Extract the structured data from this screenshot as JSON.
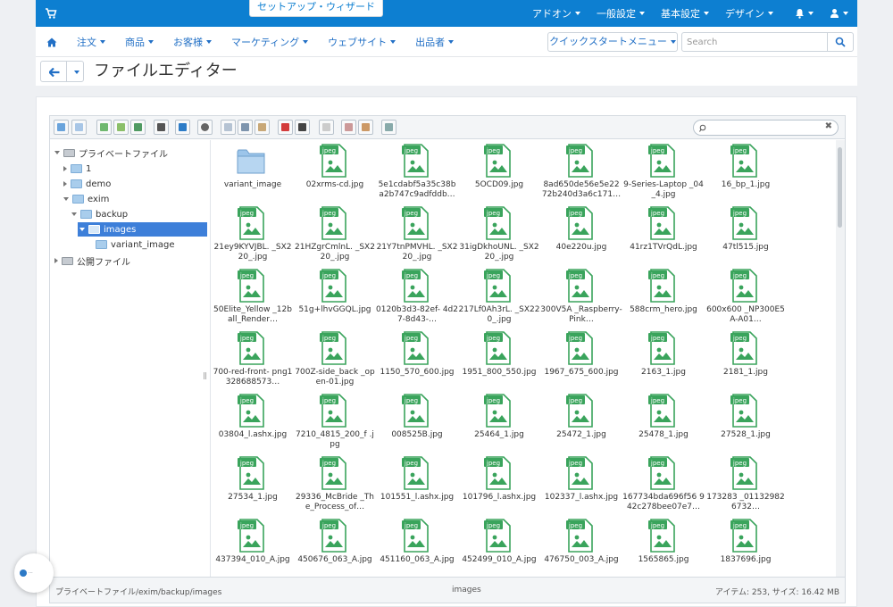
{
  "topbar": {
    "setup_wizard": "セットアップ・ウィザード",
    "menu": [
      {
        "label": "アドオン"
      },
      {
        "label": "一般設定"
      },
      {
        "label": "基本設定"
      },
      {
        "label": "デザイン"
      }
    ]
  },
  "nav": {
    "items": [
      {
        "label": "注文"
      },
      {
        "label": "商品"
      },
      {
        "label": "お客様"
      },
      {
        "label": "マーケティング"
      },
      {
        "label": "ウェブサイト"
      },
      {
        "label": "出品者"
      }
    ],
    "quickstart_label": "クイックスタートメニュー",
    "search_placeholder": "Search"
  },
  "page": {
    "title": "ファイルエディター"
  },
  "tree": {
    "nodes": [
      {
        "label": "プライベートファイル",
        "icon": "drive-icon",
        "expanded": true
      },
      {
        "label": "1",
        "icon": "folder-icon"
      },
      {
        "label": "demo",
        "icon": "folder-icon"
      },
      {
        "label": "exim",
        "icon": "folder-icon",
        "expanded": true
      },
      {
        "label": "backup",
        "icon": "folder-icon",
        "expanded": true
      },
      {
        "label": "images",
        "icon": "folder-open-icon",
        "selected": true
      },
      {
        "label": "variant_image",
        "icon": "folder-icon"
      },
      {
        "label": "公開ファイル",
        "icon": "drive-icon"
      }
    ]
  },
  "files": [
    {
      "name": "variant_image",
      "type": "folder"
    },
    {
      "name": "02xrms-cd.jpg"
    },
    {
      "name": "5e1cdabf5a35c38b a2b747c9adfddb…"
    },
    {
      "name": "5OCD09.jpg"
    },
    {
      "name": "8ad650de56e5e22 72b240d3a6c171…"
    },
    {
      "name": "9-Series-Laptop _04_4.jpg"
    },
    {
      "name": "16_bp_1.jpg"
    },
    {
      "name": "21ey9KYVJBL. _SX220_.jpg"
    },
    {
      "name": "21HZgrCmlnL. _SX220_.jpg"
    },
    {
      "name": "21Y7tnPMVHL. _SX220_.jpg"
    },
    {
      "name": "31igDkhoUNL. _SX220_.jpg"
    },
    {
      "name": "40e220u.jpg"
    },
    {
      "name": "41rz1TVrQdL.jpg"
    },
    {
      "name": "47tl515.jpg"
    },
    {
      "name": "50Elite_Yellow _12ball_Render…"
    },
    {
      "name": "51g+lhvGGQL.jpg"
    },
    {
      "name": "0120b3d3-82ef- 4d27-8d43-…"
    },
    {
      "name": "217Lf0Ah3rL. _SX220_.jpg"
    },
    {
      "name": "300V5A _Raspberry-Pink…"
    },
    {
      "name": "588crm_hero.jpg"
    },
    {
      "name": "600x600 _NP300E5A-A01…"
    },
    {
      "name": "700-red-front- png1328688573…"
    },
    {
      "name": "700Z-side_back _open-01.jpg"
    },
    {
      "name": "1150_570_600.jpg"
    },
    {
      "name": "1951_800_550.jpg"
    },
    {
      "name": "1967_675_600.jpg"
    },
    {
      "name": "2163_1.jpg"
    },
    {
      "name": "2181_1.jpg"
    },
    {
      "name": "03804_l.ashx.jpg"
    },
    {
      "name": "7210_4815_200_f .jpg"
    },
    {
      "name": "008525B.jpg"
    },
    {
      "name": "25464_1.jpg"
    },
    {
      "name": "25472_1.jpg"
    },
    {
      "name": "25478_1.jpg"
    },
    {
      "name": "27528_1.jpg"
    },
    {
      "name": "27534_1.jpg"
    },
    {
      "name": "29336_McBride _The_Process_of…"
    },
    {
      "name": "101551_l.ashx.jpg"
    },
    {
      "name": "101796_l.ashx.jpg"
    },
    {
      "name": "102337_l.ashx.jpg"
    },
    {
      "name": "167734bda696f56 942c278bee07e7…"
    },
    {
      "name": "173283 _011329826732…"
    },
    {
      "name": "437394_010_A.jpg"
    },
    {
      "name": "450676_063_A.jpg"
    },
    {
      "name": "451160_063_A.jpg"
    },
    {
      "name": "452499_010_A.jpg"
    },
    {
      "name": "476750_003_A.jpg"
    },
    {
      "name": "1565865.jpg"
    },
    {
      "name": "1837696.jpg"
    }
  ],
  "file_icon_label": "jpeg",
  "status": {
    "path": "プライベートファイル/exim/backup/images",
    "folder": "images",
    "summary": "アイテム: 253, サイズ: 16.42 MB"
  },
  "colors": {
    "topbar": "#0d7fd1",
    "link": "#2270c6",
    "selected": "#3d7fd9",
    "file_icon": "#3aa45c"
  }
}
